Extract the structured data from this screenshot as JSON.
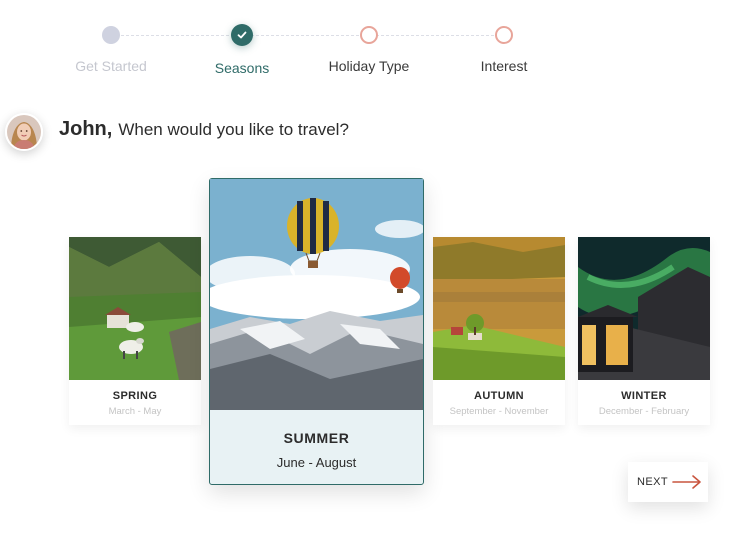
{
  "stepper": {
    "steps": [
      {
        "label": "Get Started",
        "state": "done"
      },
      {
        "label": "Seasons",
        "state": "current"
      },
      {
        "label": "Holiday Type",
        "state": "pending"
      },
      {
        "label": "Interest",
        "state": "pending"
      }
    ]
  },
  "question": {
    "name": "John,",
    "text": "When would you like to travel?"
  },
  "seasons": [
    {
      "title": "SPRING",
      "range": "March - May",
      "selected": false
    },
    {
      "title": "SUMMER",
      "range": "June - August",
      "selected": true
    },
    {
      "title": "AUTUMN",
      "range": "September - November",
      "selected": false
    },
    {
      "title": "WINTER",
      "range": "December - February",
      "selected": false
    }
  ],
  "next": {
    "label": "NEXT",
    "icon": "arrow-right-icon"
  },
  "colors": {
    "accent": "#2f6b68",
    "pending": "#e8a59a",
    "done": "#cfd2e0",
    "selected_bg": "#e8f2f4"
  }
}
